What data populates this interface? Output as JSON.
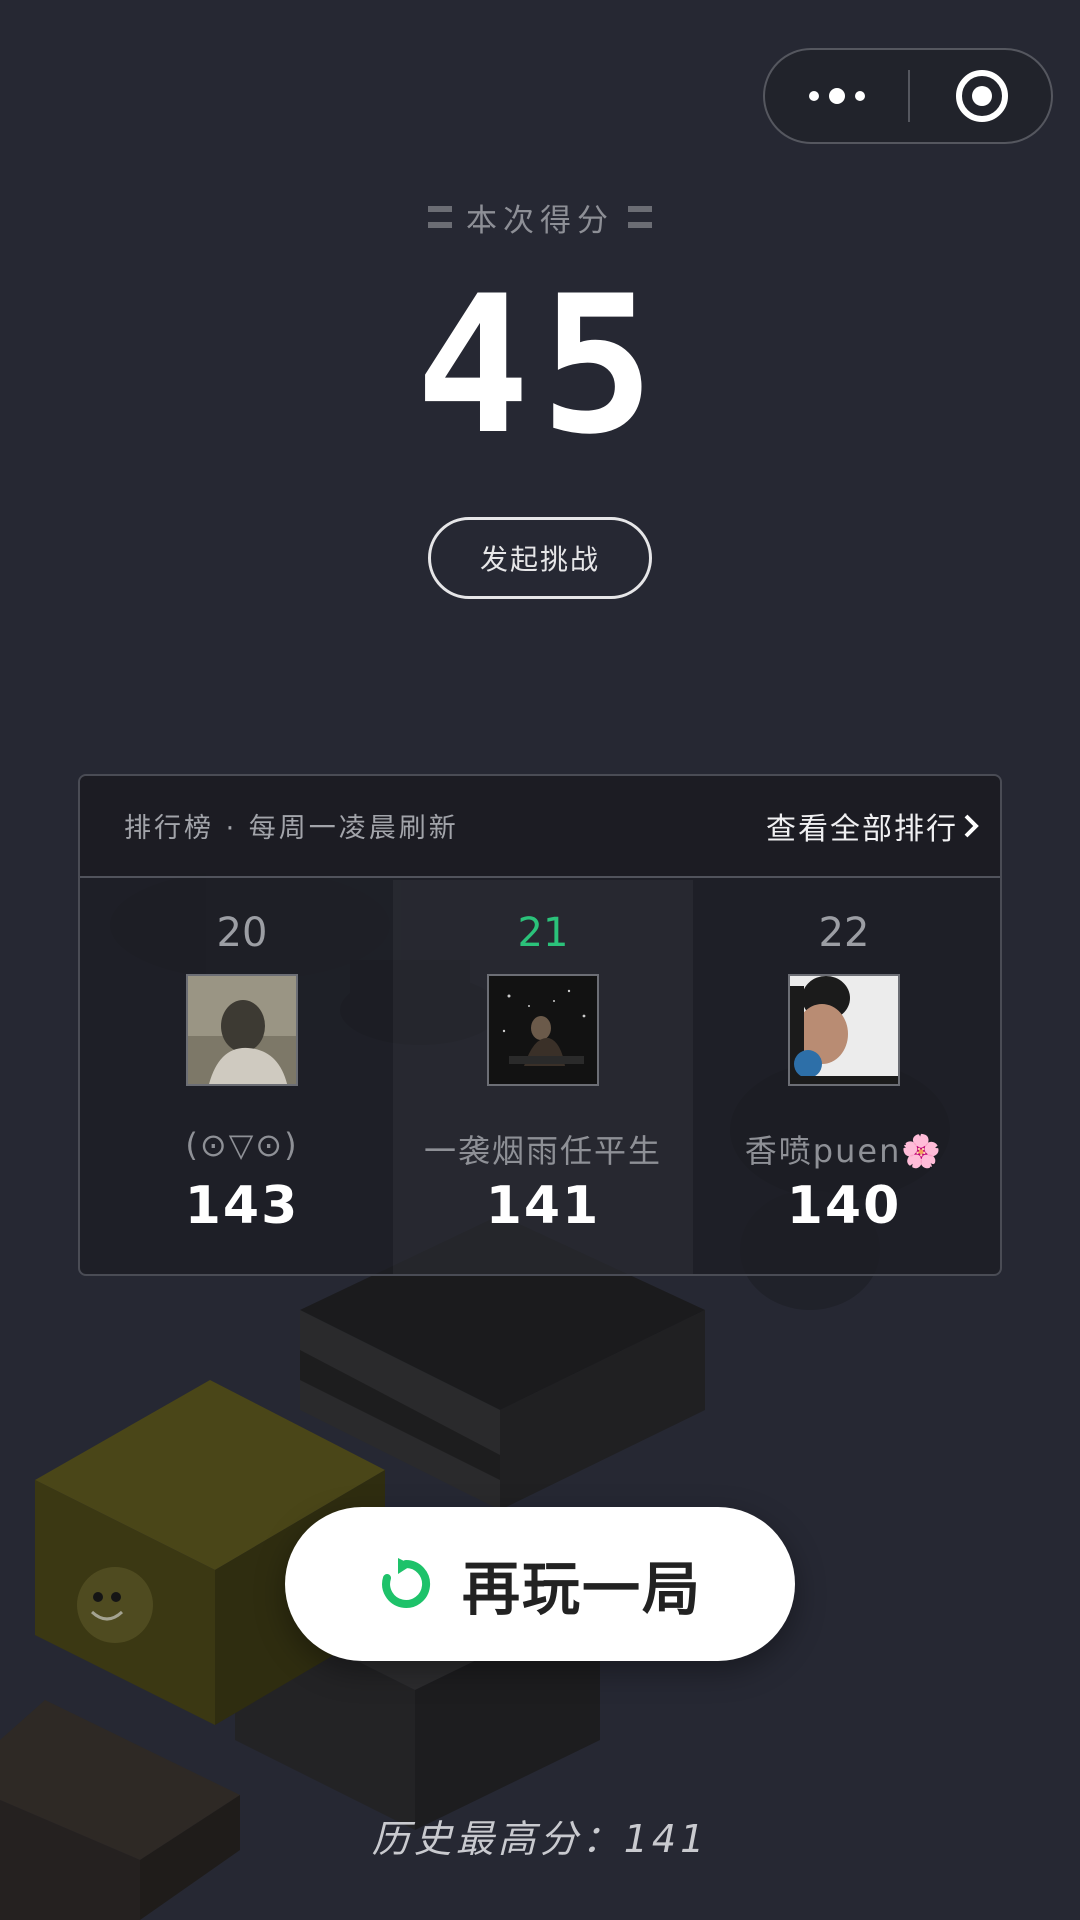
{
  "capsule": {
    "more_icon": "more-dots-icon",
    "close_icon": "target-circle-icon"
  },
  "result": {
    "title": "本次得分",
    "score": "45",
    "challenge_label": "发起挑战"
  },
  "leaderboard": {
    "title": "排行榜 · 每周一凌晨刷新",
    "view_all_label": "查看全部排行",
    "entries": [
      {
        "rank": "20",
        "name": "(⊙▽⊙)",
        "score": "143",
        "current": false
      },
      {
        "rank": "21",
        "name": "一袭烟雨任平生",
        "score": "141",
        "current": true
      },
      {
        "rank": "22",
        "name": "香喷puen🌸",
        "score": "140",
        "current": false
      }
    ]
  },
  "replay": {
    "label": "再玩一局",
    "icon": "replay-icon"
  },
  "best": {
    "text": "历史最高分：141"
  },
  "colors": {
    "background": "#262833",
    "accent_green": "#2bc27a",
    "button_bg": "#ffffff"
  }
}
